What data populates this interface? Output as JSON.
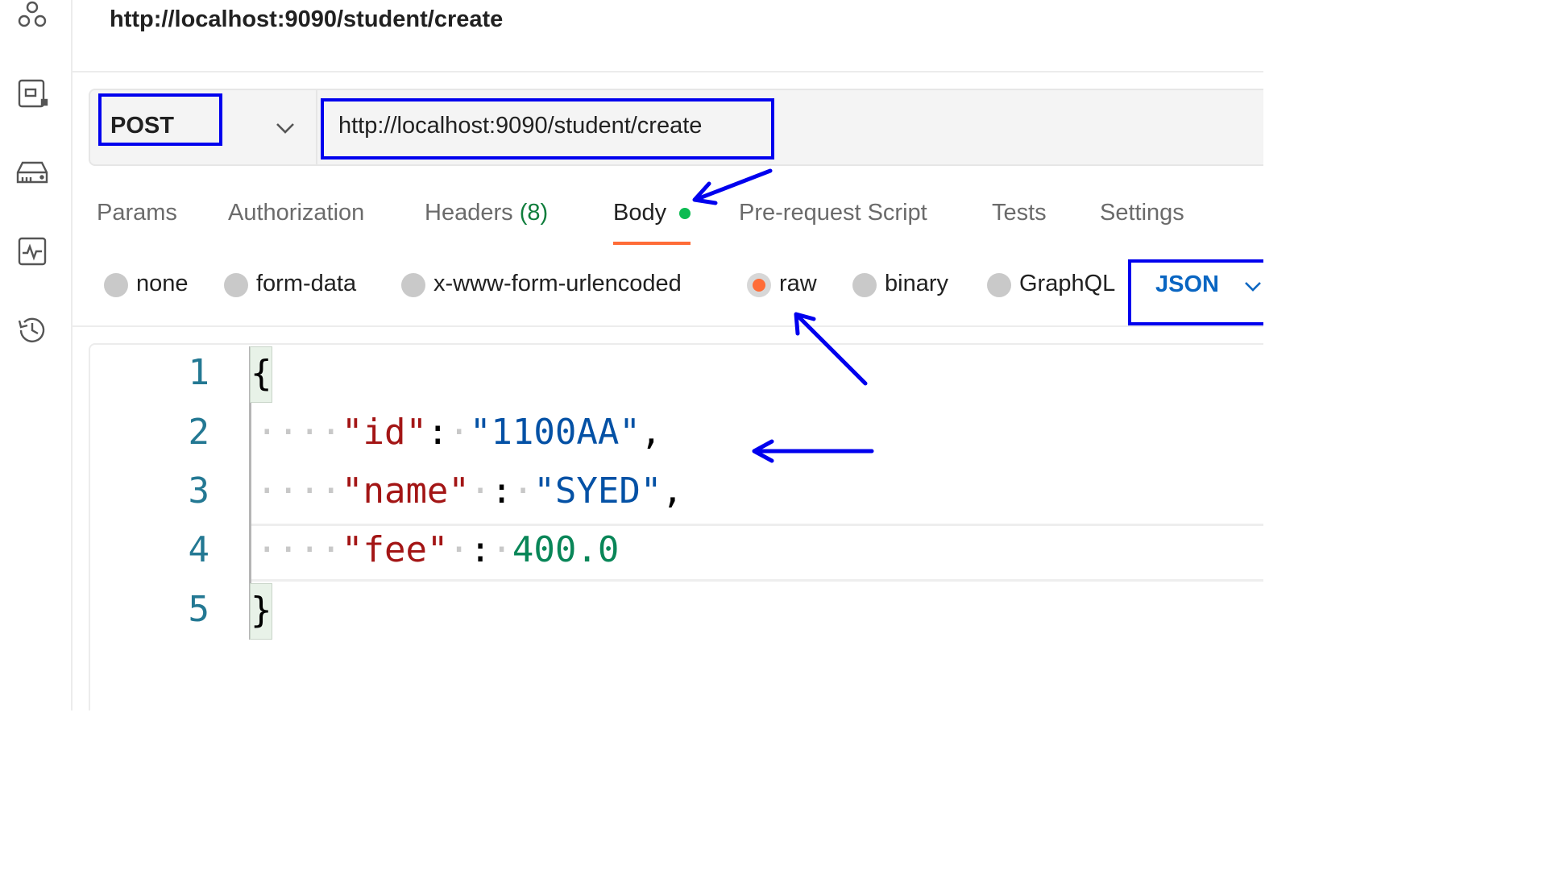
{
  "tab_title": "http://localhost:9090/student/create",
  "request": {
    "method": "POST",
    "url": "http://localhost:9090/student/create"
  },
  "request_tabs": [
    {
      "label": "Params"
    },
    {
      "label": "Authorization"
    },
    {
      "label": "Headers",
      "count": "(8)"
    },
    {
      "label": "Body",
      "active": true
    },
    {
      "label": "Pre-request Script"
    },
    {
      "label": "Tests"
    },
    {
      "label": "Settings"
    }
  ],
  "body_types": [
    {
      "label": "none",
      "selected": false
    },
    {
      "label": "form-data",
      "selected": false
    },
    {
      "label": "x-www-form-urlencoded",
      "selected": false
    },
    {
      "label": "raw",
      "selected": true
    },
    {
      "label": "binary",
      "selected": false
    },
    {
      "label": "GraphQL",
      "selected": false
    }
  ],
  "raw_language": "JSON",
  "editor": {
    "line_numbers": [
      "1",
      "2",
      "3",
      "4",
      "5"
    ],
    "open_brace": "{",
    "close_brace": "}",
    "indent": "····",
    "lines": [
      {
        "key": "\"id\"",
        "sep_before": "",
        "colon": ":",
        "sep_after": "·",
        "value": "\"1100AA\"",
        "value_type": "string",
        "trail": ","
      },
      {
        "key": "\"name\"",
        "sep_before": "·",
        "colon": ":",
        "sep_after": "·",
        "value": "\"SYED\"",
        "value_type": "string",
        "trail": ","
      },
      {
        "key": "\"fee\"",
        "sep_before": "·",
        "colon": ":",
        "sep_after": "·",
        "value": "400.0",
        "value_type": "number",
        "trail": ""
      }
    ]
  },
  "colors": {
    "accent": "#ff6c37",
    "annotation": "#0000ee",
    "json_key": "#a31515",
    "json_string": "#0451a5",
    "json_number": "#098658"
  },
  "icons": [
    "apis-icon",
    "environments-icon",
    "mock-servers-icon",
    "monitors-icon",
    "history-icon",
    "chevron-down-icon"
  ]
}
